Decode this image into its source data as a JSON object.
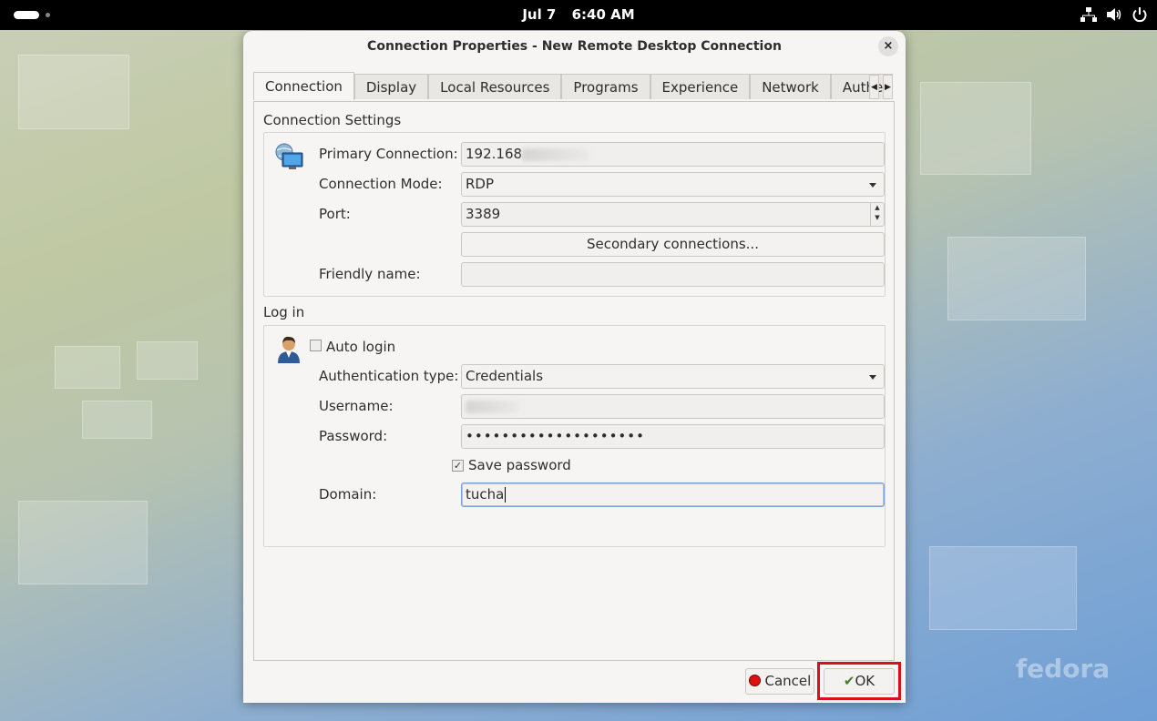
{
  "topbar": {
    "date": "Jul 7",
    "time": "6:40 AM",
    "icons": [
      "network-icon",
      "volume-icon",
      "power-icon"
    ]
  },
  "dialog": {
    "title": "Connection Properties - New Remote Desktop Connection",
    "close_label": "×",
    "tabs": [
      "Connection",
      "Display",
      "Local Resources",
      "Programs",
      "Experience",
      "Network",
      "Authent"
    ],
    "active_tab": "Connection",
    "connection_settings": {
      "section_title": "Connection Settings",
      "primary_connection_label": "Primary Connection:",
      "primary_connection_value": "192.168",
      "connection_mode_label": "Connection Mode:",
      "connection_mode_value": "RDP",
      "port_label": "Port:",
      "port_value": "3389",
      "secondary_connections_label": "Secondary connections...",
      "friendly_name_label": "Friendly name:",
      "friendly_name_value": ""
    },
    "login": {
      "section_title": "Log in",
      "auto_login_label": "Auto login",
      "auto_login_checked": false,
      "auth_type_label": "Authentication type:",
      "auth_type_value": "Credentials",
      "username_label": "Username:",
      "password_label": "Password:",
      "password_value": "••••••••••••••••••••",
      "save_password_label": "Save password",
      "save_password_checked": true,
      "save_password_mark": "✓",
      "domain_label": "Domain:",
      "domain_value": "tucha"
    },
    "buttons": {
      "cancel_label": "Cancel",
      "ok_label": "OK"
    }
  },
  "watermark": "fedora",
  "colors": {
    "highlight_box": "#d6101d",
    "topbar": "#000000"
  }
}
